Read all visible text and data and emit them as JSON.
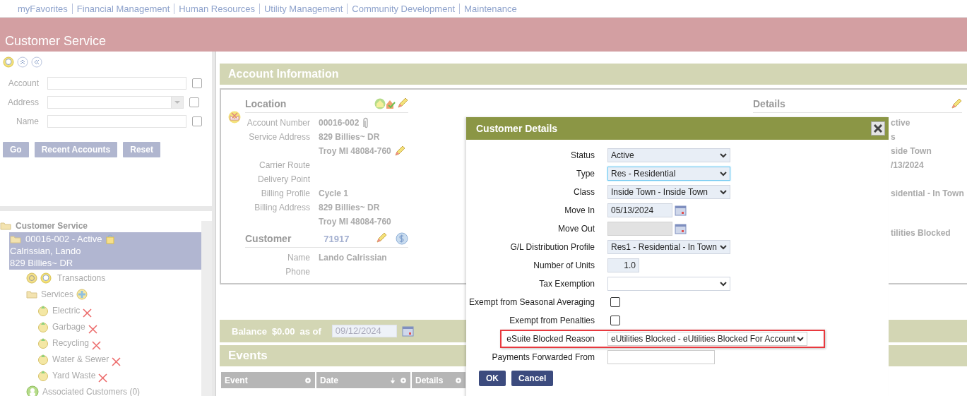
{
  "nav": [
    "myFavorites",
    "Financial Management",
    "Human Resources",
    "Utility Management",
    "Community Development",
    "Maintenance"
  ],
  "header": {
    "title": "Customer Service"
  },
  "search": {
    "fields": [
      {
        "label": "Account",
        "kind": "text",
        "checked": false
      },
      {
        "label": "Address",
        "kind": "combo",
        "checked": false
      },
      {
        "label": "Name",
        "kind": "text",
        "checked": false
      }
    ],
    "buttons": [
      "Go",
      "Recent Accounts",
      "Reset"
    ]
  },
  "tree": {
    "label": "Customer Service",
    "children": [
      {
        "label": "00016-002 - Active",
        "kind": "account",
        "lines": [
          "Calrissian, Lando",
          "829 Billies~ DR"
        ],
        "selected": true,
        "children": [
          {
            "label": "Transactions",
            "kind": "search"
          },
          {
            "label": "Services",
            "kind": "folder",
            "children": [
              {
                "label": "Electric",
                "kind": "service",
                "inactive": true
              },
              {
                "label": "Garbage",
                "kind": "service",
                "inactive": true
              },
              {
                "label": "Recycling",
                "kind": "service",
                "inactive": true
              },
              {
                "label": "Water & Sewer",
                "kind": "service",
                "inactive": true
              },
              {
                "label": "Yard Waste",
                "kind": "service",
                "inactive": true
              }
            ]
          },
          {
            "label": "Associated Customers (0)",
            "kind": "people"
          }
        ]
      }
    ]
  },
  "account": {
    "title": "Account Information",
    "location": {
      "title": "Location",
      "rows": [
        {
          "label": "Account Number",
          "values": [
            "00016-002"
          ],
          "kind": "attach"
        },
        {
          "label": "Service Address",
          "values": [
            "829 Billies~ DR",
            "Troy MI 48084-760"
          ],
          "kind": "edit"
        },
        {
          "label": "Carrier Route",
          "values": []
        },
        {
          "label": "Delivery Point",
          "values": []
        },
        {
          "label": "Billing Profile",
          "values": [
            "Cycle 1"
          ]
        },
        {
          "label": "Billing Address",
          "values": [
            "829 Billies~ DR",
            "Troy MI 48084-760"
          ]
        }
      ]
    },
    "customer": {
      "title": "Customer",
      "number": "71917",
      "rows": [
        {
          "label": "Name",
          "values": [
            "Lando Calrissian"
          ]
        },
        {
          "label": "Phone",
          "values": []
        }
      ]
    },
    "details": {
      "title": "Details",
      "groups": [
        [
          "ctive",
          "s",
          "side Town",
          "/13/2024"
        ],
        [
          "sidential - In Town"
        ],
        [
          "tilities Blocked"
        ]
      ]
    }
  },
  "balance": {
    "label": "Balance",
    "amount": "$0.00",
    "as_of": "as of",
    "date": "09/12/2024"
  },
  "events": {
    "title": "Events",
    "columns": [
      {
        "label": "Event",
        "sort": false
      },
      {
        "label": "Date",
        "sort": true
      },
      {
        "label": "Details",
        "sort": false
      }
    ]
  },
  "dialog": {
    "title": "Customer Details",
    "fields": [
      {
        "label": "Status",
        "kind": "select",
        "value": "Active"
      },
      {
        "label": "Type",
        "kind": "select",
        "value": "Res - Residential",
        "focused": true
      },
      {
        "label": "Class",
        "kind": "select",
        "value": "Inside Town - Inside Town"
      },
      {
        "label": "Move In",
        "kind": "date",
        "value": "05/13/2024"
      },
      {
        "label": "Move Out",
        "kind": "date",
        "disabled": true
      },
      {
        "label": "G/L Distribution Profile",
        "kind": "select",
        "value": "Res1 - Residential - In Town"
      },
      {
        "label": "Number of Units",
        "kind": "number",
        "value": "1.0"
      },
      {
        "label": "Tax Exemption",
        "kind": "select"
      },
      {
        "label": "Exempt from Seasonal Averaging",
        "kind": "checkbox",
        "checked": false
      },
      {
        "label": "Exempt from Penalties",
        "kind": "checkbox",
        "checked": false
      },
      {
        "label": "eSuite Blocked Reason",
        "kind": "select",
        "value": "eUtilities Blocked - eUtilities Blocked For Account",
        "highlighted": true
      },
      {
        "label": "Payments Forwarded From",
        "kind": "text"
      }
    ],
    "buttons": [
      "OK",
      "Cancel"
    ]
  }
}
